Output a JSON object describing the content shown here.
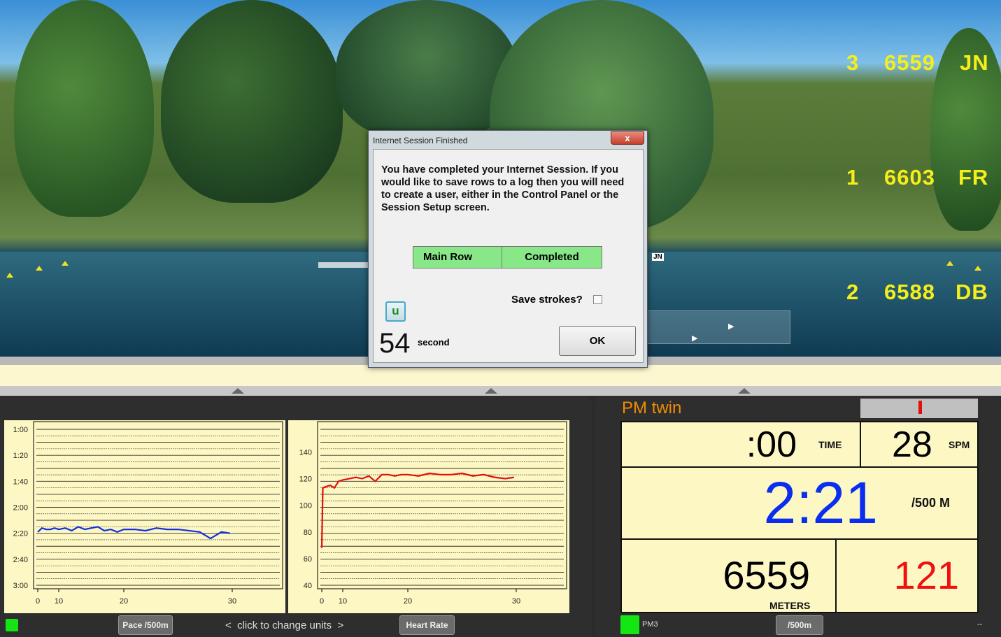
{
  "scene": {
    "leaderboard": [
      {
        "place": "3",
        "meters": "6559",
        "name": "JN"
      },
      {
        "place": "1",
        "meters": "6603",
        "name": "FR"
      },
      {
        "place": "2",
        "meters": "6588",
        "name": "DB"
      }
    ],
    "boat_tag": "JN"
  },
  "dialog": {
    "title": "Internet Session Finished",
    "message": "You have completed your Internet Session.  If you would like to save rows to a log then you will need to create a user, either in the Control Panel or the Session Setup screen.",
    "table": {
      "col1": "Main Row",
      "col2": "Completed"
    },
    "save_strokes_label": "Save strokes?",
    "save_strokes_checked": false,
    "u_button": "u",
    "countdown": "54",
    "countdown_unit": "second",
    "ok": "OK",
    "close": "x"
  },
  "bottom_left": {
    "pace_button": "Pace /500m",
    "change_units": "<  click to change units  >",
    "hr_button": "Heart Rate"
  },
  "monitor": {
    "title": "PM twin",
    "time": ":00",
    "time_label": "TIME",
    "spm": "28",
    "spm_label": "SPM",
    "pace": "2:21",
    "pace_label": "/500 M",
    "meters": "6559",
    "meters_label": "METERS",
    "heart_rate": "121",
    "pm_label": "PM3",
    "unit_button": "/500m",
    "dash": "--",
    "colors": {
      "title": "#f08c00",
      "pace": "#0a2ef0",
      "heart_rate": "#f01010"
    }
  },
  "chart_data": [
    {
      "type": "line",
      "title": "",
      "xlabel": "",
      "ylabel": "",
      "x_ticks": [
        "0",
        "10",
        "20",
        "30"
      ],
      "y_ticks": [
        "1:00",
        "1:20",
        "1:40",
        "2:00",
        "2:20",
        "2:40",
        "3:00"
      ],
      "ylim_seconds": [
        60,
        180
      ],
      "y_inverted": true,
      "grid": true,
      "color": "#1030e0",
      "series": [
        {
          "x": [
            0,
            2,
            4,
            6,
            8,
            10,
            11,
            12,
            13,
            14,
            15,
            16,
            17,
            18,
            19,
            20,
            21,
            22,
            23,
            24,
            25,
            26,
            27,
            28,
            29,
            29.8
          ],
          "y": [
            139,
            136,
            137,
            137,
            136,
            137,
            136,
            138,
            135,
            137,
            136,
            135,
            138,
            137,
            139,
            137,
            137,
            138,
            136,
            137,
            137,
            138,
            139,
            144,
            139,
            140
          ]
        }
      ]
    },
    {
      "type": "line",
      "title": "",
      "xlabel": "",
      "ylabel": "",
      "x_ticks": [
        "0",
        "10",
        "20",
        "30"
      ],
      "y_ticks": [
        "40",
        "60",
        "80",
        "100",
        "120",
        "140"
      ],
      "ylim": [
        40,
        157
      ],
      "grid": true,
      "color": "#e01010",
      "series": [
        {
          "x": [
            0,
            0.5,
            2,
            4,
            6,
            8,
            10,
            11,
            12,
            13,
            14,
            15,
            16,
            17,
            18,
            19,
            20,
            21,
            22,
            23,
            24,
            25,
            26,
            27,
            28,
            29,
            29.8
          ],
          "y": [
            68,
            113,
            114,
            115,
            113,
            118,
            119,
            120,
            121,
            120,
            122,
            118,
            123,
            123,
            122,
            123,
            123,
            122,
            124,
            123,
            123,
            124,
            122,
            123,
            121,
            120,
            121
          ]
        }
      ]
    }
  ]
}
